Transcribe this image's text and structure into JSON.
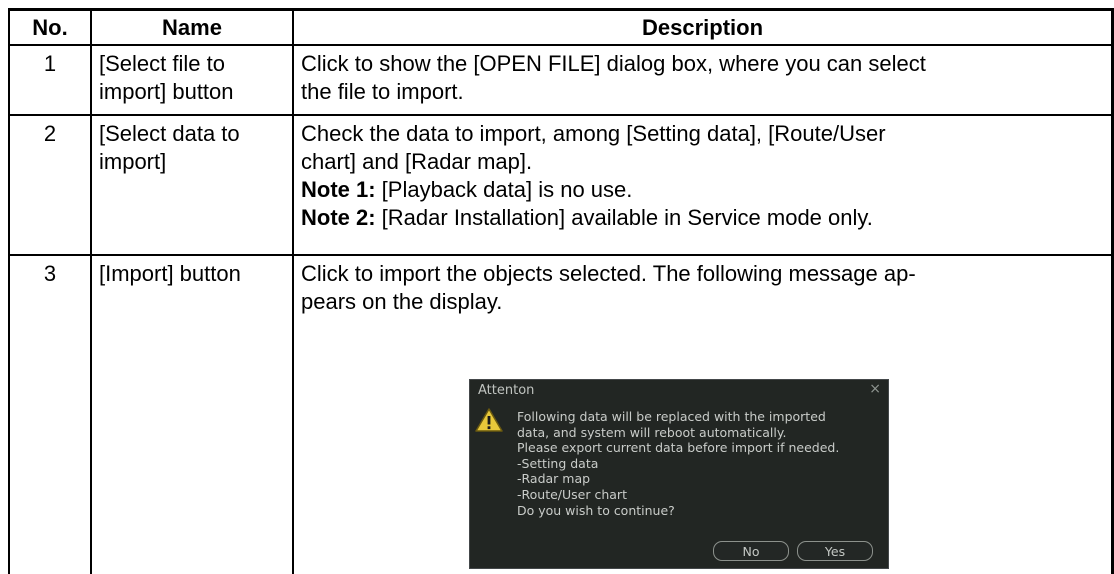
{
  "table": {
    "headers": {
      "no": "No.",
      "name": "Name",
      "description": "Description"
    },
    "rows": [
      {
        "no": "1",
        "name_lines": [
          "[Select file to",
          "import] button"
        ],
        "desc_lines": [
          "Click to show the [OPEN FILE] dialog box, where you can select",
          "the file to import."
        ]
      },
      {
        "no": "2",
        "name_lines": [
          "[Select data to",
          "import]"
        ],
        "desc_lines": [
          "Check the data to import, among [Setting data], [Route/User",
          "chart] and [Radar map]."
        ],
        "notes": [
          {
            "label": "Note 1:",
            "text": " [Playback data] is no use."
          },
          {
            "label": "Note 2:",
            "text": " [Radar Installation] available in Service mode only."
          }
        ]
      },
      {
        "no": "3",
        "name_lines": [
          "[Import] button"
        ],
        "desc_lines": [
          "Click to import the objects selected. The following message ap-",
          "pears on the display."
        ]
      }
    ]
  },
  "dialog": {
    "title": "Attenton",
    "close_glyph": "×",
    "icon": "warning-icon",
    "message_lines": [
      "Following data will be replaced with the imported",
      "data, and system will reboot automatically.",
      "Please export current data before import if needed.",
      "-Setting data",
      "-Radar map",
      "-Route/User chart",
      "Do you wish to continue?"
    ],
    "no_label": "No",
    "yes_label": "Yes"
  }
}
